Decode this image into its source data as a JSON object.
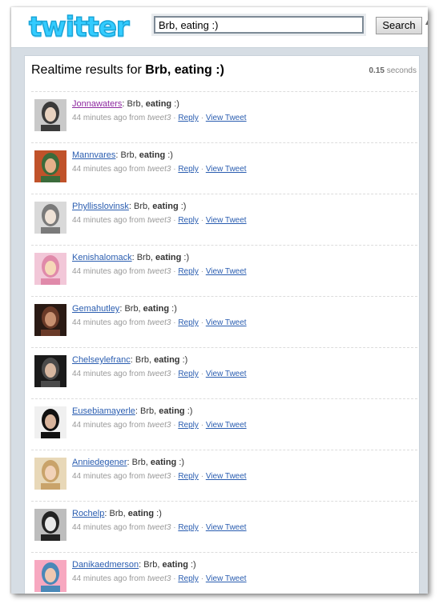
{
  "header": {
    "logo_text": "twitter",
    "search_value": "Brb, eating :)",
    "search_button_label": "Search"
  },
  "results": {
    "title_prefix": "Realtime results for ",
    "query": "Brb, eating :)",
    "time_value": "0.15",
    "time_unit": " seconds"
  },
  "tweet_template": {
    "text_before": "Brb, ",
    "text_bold": "eating",
    "text_after": " :)",
    "time_ago": "44 minutes ago from",
    "source": "tweet3",
    "separator": "·",
    "reply_label": "Reply",
    "view_label": "View Tweet"
  },
  "tweets": [
    {
      "username": "Jonnawaters",
      "visited": true
    },
    {
      "username": "Mannvares",
      "visited": false
    },
    {
      "username": "Phyllisslovinsk",
      "visited": false
    },
    {
      "username": "Kenishalomack",
      "visited": false
    },
    {
      "username": "Gemahutley",
      "visited": false
    },
    {
      "username": "Chelseylefranc",
      "visited": false
    },
    {
      "username": "Eusebiamayerle",
      "visited": false
    },
    {
      "username": "Anniedegener",
      "visited": false
    },
    {
      "username": "Rochelp",
      "visited": false
    },
    {
      "username": "Danikaedmerson",
      "visited": false
    }
  ],
  "colors": {
    "link": "#2a5db0",
    "visited_link": "#8e2aa0",
    "logo": "#33ccff"
  }
}
